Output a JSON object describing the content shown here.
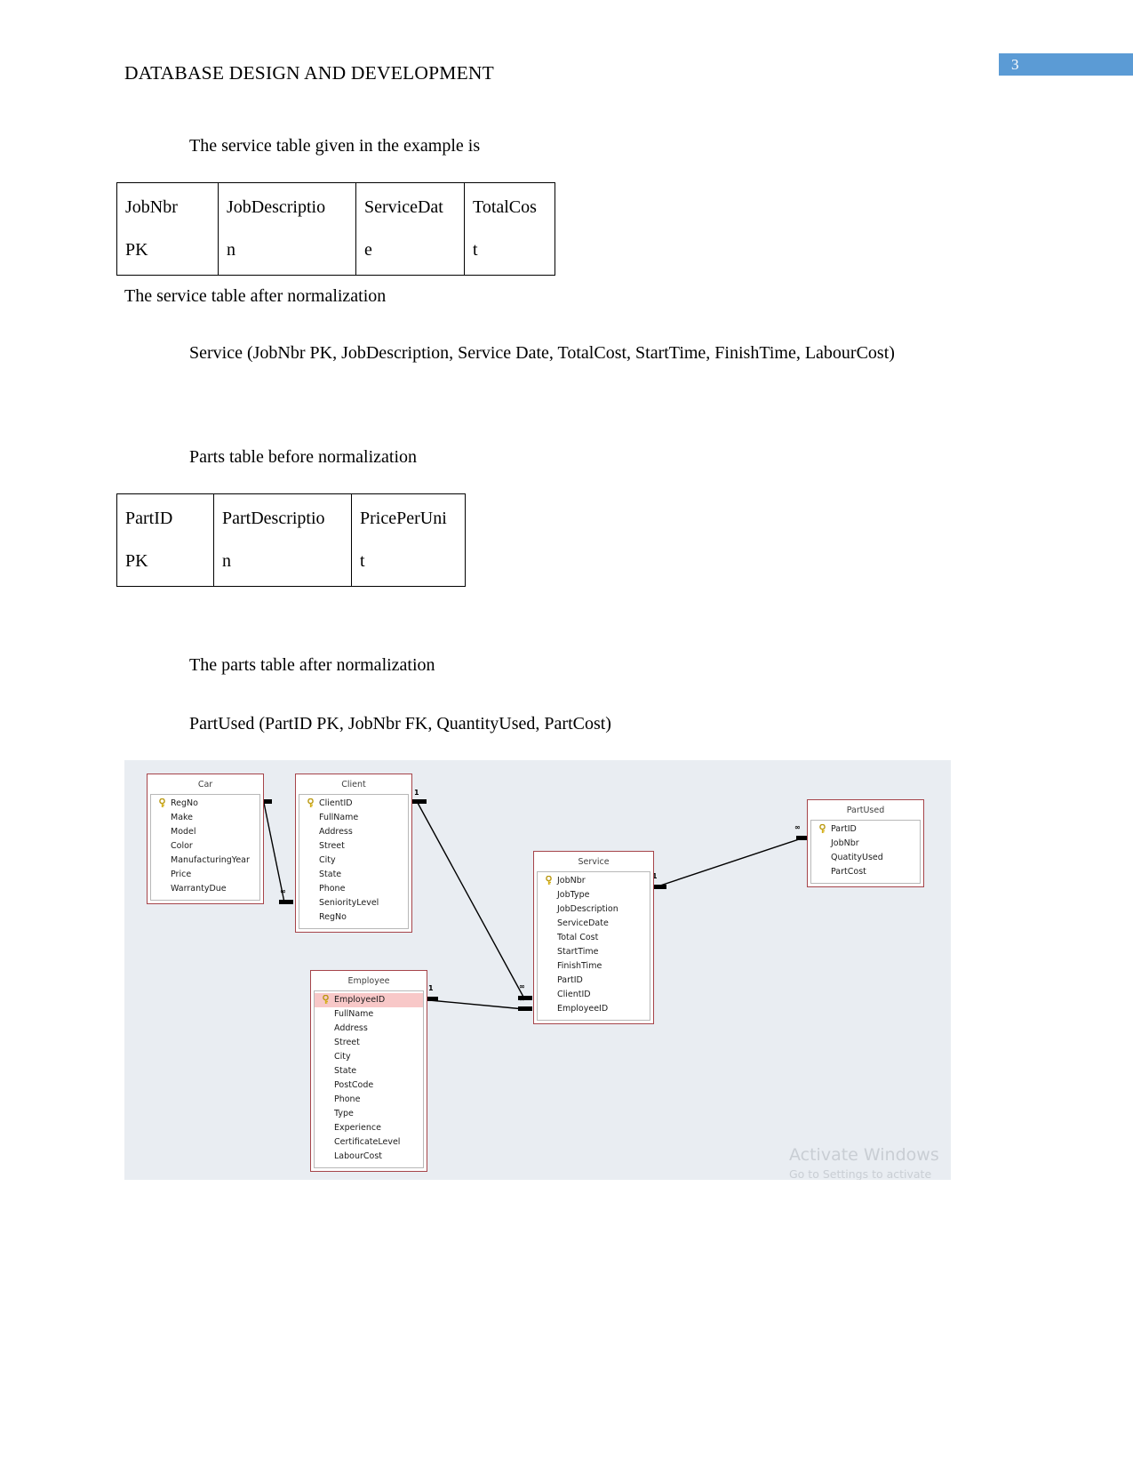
{
  "page": {
    "number": "3",
    "badge_color": "#5b9bd5",
    "header": "DATABASE DESIGN AND DEVELOPMENT"
  },
  "body": {
    "service_intro": "The service table given in the example is",
    "service_after_caption": "The service table after normalization",
    "service_definition": "Service (JobNbr PK, JobDescription, Service Date, TotalCost, StartTime, FinishTime, LabourCost)",
    "parts_before_caption": "Parts table before normalization",
    "parts_after_caption": "The parts table after normalization",
    "partused_definition": "PartUsed (PartID PK, JobNbr FK, QuantityUsed, PartCost)"
  },
  "service_table": {
    "columns": [
      "JobNbr",
      "JobDescriptio",
      "ServiceDat",
      "TotalCos"
    ],
    "second_line": [
      "PK",
      "n",
      "e",
      "t"
    ]
  },
  "parts_table": {
    "columns": [
      "PartID",
      "PartDescriptio",
      "PricePerUni"
    ],
    "second_line": [
      "PK",
      "n",
      "t"
    ]
  },
  "er_diagram": {
    "background": "#e9edf2",
    "entity_border": "#a6444a",
    "highlight_color": "#f8c8c8",
    "entities": [
      {
        "name": "Car",
        "fields": [
          {
            "label": "RegNo",
            "pk": true
          },
          {
            "label": "Make",
            "pk": false
          },
          {
            "label": "Model",
            "pk": false
          },
          {
            "label": "Color",
            "pk": false
          },
          {
            "label": "ManufacturingYear",
            "pk": false
          },
          {
            "label": "Price",
            "pk": false
          },
          {
            "label": "WarrantyDue",
            "pk": false
          }
        ]
      },
      {
        "name": "Client",
        "fields": [
          {
            "label": "ClientID",
            "pk": true
          },
          {
            "label": "FullName",
            "pk": false
          },
          {
            "label": "Address",
            "pk": false
          },
          {
            "label": "Street",
            "pk": false
          },
          {
            "label": "City",
            "pk": false
          },
          {
            "label": "State",
            "pk": false
          },
          {
            "label": "Phone",
            "pk": false
          },
          {
            "label": "SeniorityLevel",
            "pk": false
          },
          {
            "label": "RegNo",
            "pk": false
          }
        ]
      },
      {
        "name": "Employee",
        "fields": [
          {
            "label": "EmployeeID",
            "pk": true,
            "highlight": true
          },
          {
            "label": "FullName",
            "pk": false
          },
          {
            "label": "Address",
            "pk": false
          },
          {
            "label": "Street",
            "pk": false
          },
          {
            "label": "City",
            "pk": false
          },
          {
            "label": "State",
            "pk": false
          },
          {
            "label": "PostCode",
            "pk": false
          },
          {
            "label": "Phone",
            "pk": false
          },
          {
            "label": "Type",
            "pk": false
          },
          {
            "label": "Experience",
            "pk": false
          },
          {
            "label": "CertificateLevel",
            "pk": false
          },
          {
            "label": "LabourCost",
            "pk": false
          }
        ]
      },
      {
        "name": "Service",
        "fields": [
          {
            "label": "JobNbr",
            "pk": true
          },
          {
            "label": "JobType",
            "pk": false
          },
          {
            "label": "JobDescription",
            "pk": false
          },
          {
            "label": "ServiceDate",
            "pk": false
          },
          {
            "label": "Total Cost",
            "pk": false
          },
          {
            "label": "StartTime",
            "pk": false
          },
          {
            "label": "FinishTime",
            "pk": false
          },
          {
            "label": "PartID",
            "pk": false
          },
          {
            "label": "ClientID",
            "pk": false
          },
          {
            "label": "EmployeeID",
            "pk": false
          }
        ]
      },
      {
        "name": "PartUsed",
        "fields": [
          {
            "label": "PartID",
            "pk": true
          },
          {
            "label": "JobNbr",
            "pk": false
          },
          {
            "label": "QuatityUsed",
            "pk": false
          },
          {
            "label": "PartCost",
            "pk": false
          }
        ]
      }
    ],
    "relationships": [
      {
        "from": "Car",
        "to": "Client",
        "from_card": "1",
        "to_card": "∞"
      },
      {
        "from": "Client",
        "to": "Service",
        "from_card": "1",
        "to_card": "∞"
      },
      {
        "from": "Employee",
        "to": "Service",
        "from_card": "1",
        "to_card": "∞"
      },
      {
        "from": "Service",
        "to": "PartUsed",
        "from_card": "1",
        "to_card": "∞"
      }
    ]
  },
  "watermark": {
    "title": "Activate Windows",
    "subtitle": "Go to Settings to activate Windows."
  }
}
